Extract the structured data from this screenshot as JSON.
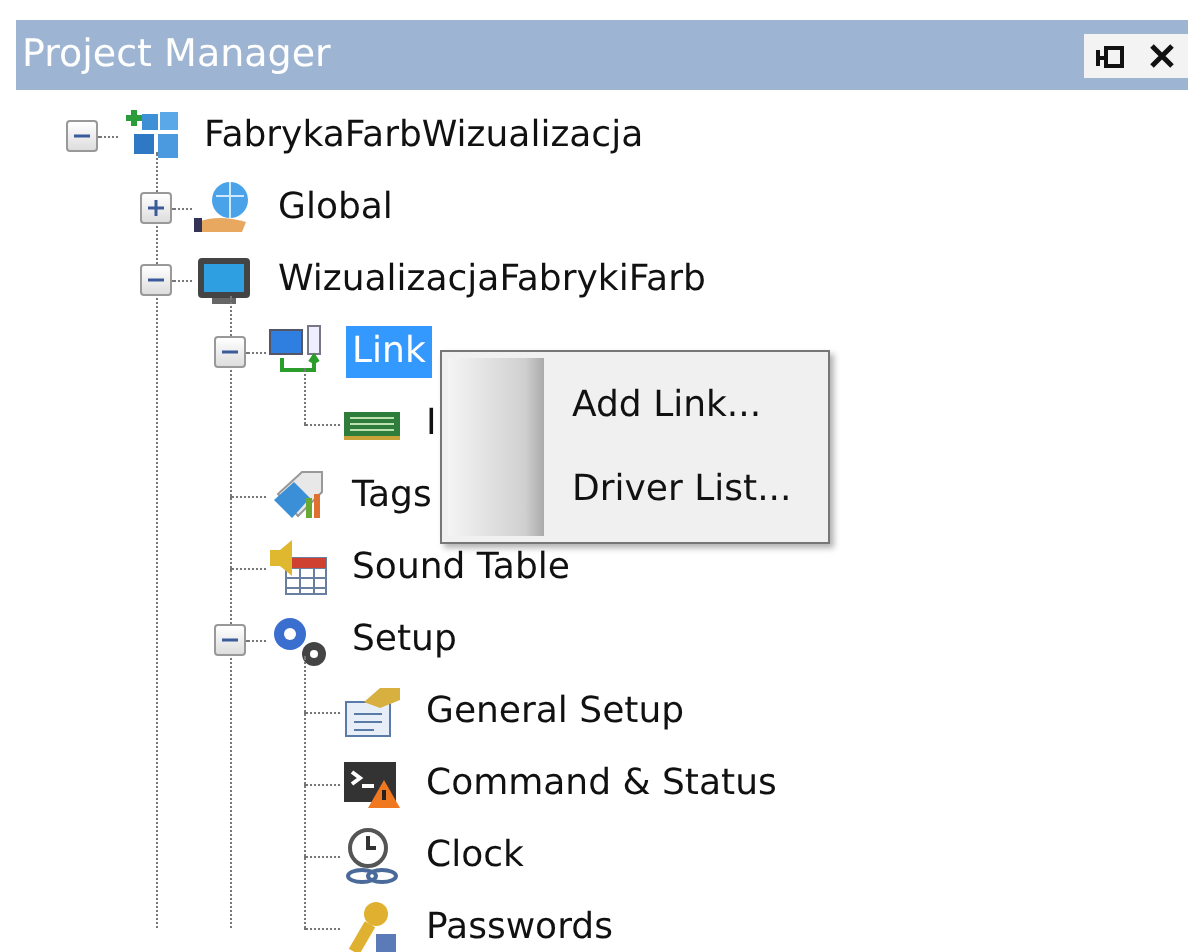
{
  "panel": {
    "title": "Project Manager"
  },
  "tree": [
    {
      "label": "FabrykaFarbWizualizacja",
      "kind": "project",
      "expanded": true,
      "selected": false,
      "children": [
        {
          "label": "Global",
          "kind": "global",
          "expanded": false,
          "selected": false
        },
        {
          "label": "WizualizacjaFabrykiFarb",
          "kind": "screen",
          "expanded": true,
          "selected": false,
          "children": [
            {
              "label": "Link",
              "kind": "links",
              "expanded": true,
              "selected": true,
              "children": [
                {
                  "label": "I",
                  "kind": "driver",
                  "selected": false
                }
              ]
            },
            {
              "label": "Tags",
              "kind": "tags",
              "selected": false
            },
            {
              "label": "Sound Table",
              "kind": "sound",
              "selected": false
            },
            {
              "label": "Setup",
              "kind": "setup",
              "expanded": true,
              "selected": false,
              "children": [
                {
                  "label": "General Setup",
                  "kind": "general",
                  "selected": false
                },
                {
                  "label": "Command & Status",
                  "kind": "command",
                  "selected": false
                },
                {
                  "label": "Clock",
                  "kind": "clock",
                  "selected": false
                },
                {
                  "label": "Passwords",
                  "kind": "passwords",
                  "selected": false
                }
              ]
            }
          ]
        }
      ]
    }
  ],
  "context_menu": {
    "items": [
      {
        "label": "Add Link..."
      },
      {
        "label": "Driver List..."
      }
    ]
  }
}
